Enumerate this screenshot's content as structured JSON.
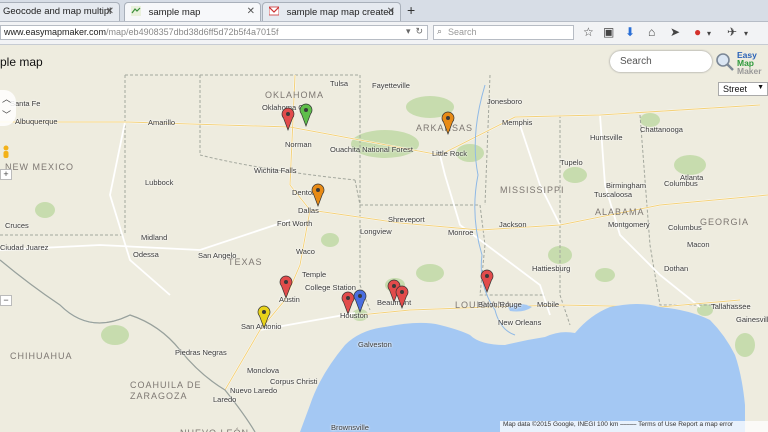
{
  "browser": {
    "tabs": [
      {
        "label": "Geocode and map multipl",
        "active": false
      },
      {
        "label": "sample map",
        "active": true
      },
      {
        "label": "sample map map created",
        "active": false
      }
    ],
    "new_tab_symbol": "+",
    "tab_close_symbol": "✕",
    "url_host": "www.easymapmaker.com",
    "url_path": "/map/eb4908357dbd38d6ff5d72b5f4a7015f",
    "search_placeholder": "Search",
    "toolbar_icons": [
      "star-icon",
      "reading-list-icon",
      "download-icon",
      "home-icon",
      "send-icon",
      "addon-icon",
      "menu-icon"
    ]
  },
  "page": {
    "title": "ple map",
    "search_placeholder": "Search",
    "logo": {
      "line1": "Easy",
      "line2": "Map",
      "line3": "Maker"
    },
    "map_type": "Street",
    "footer": "Map data ©2015 Google, INEGI    100 km ⎯⎯⎯⎯⎯     Terms of Use     Report a map error",
    "zoom_in": "+",
    "zoom_out": "−"
  },
  "map": {
    "colors": {
      "land": "#eeecdf",
      "water": "#a4c8f3",
      "park": "#c7dcae",
      "border": "#9aa19a",
      "road": "#ffffff",
      "highway": "#f6d67c"
    },
    "states": [
      {
        "text": "OKLAHOMA"
      },
      {
        "text": "ARKANSAS"
      },
      {
        "text": "MISSISSIPPI"
      },
      {
        "text": "ALABAMA"
      },
      {
        "text": "GEORGIA"
      },
      {
        "text": "TEXAS"
      },
      {
        "text": "LOUISIANA"
      },
      {
        "text": "NEW MEXICO"
      },
      {
        "text": "CHIHUAHUA"
      },
      {
        "text": "COAHUILA DE"
      },
      {
        "text": "ZARAGOZA"
      },
      {
        "text": "NUEVO LEÓN"
      }
    ],
    "cities": [
      "Tulsa",
      "Fayetteville",
      "Jonesboro",
      "Santa Fe",
      "Oklahoma City",
      "Amarillo",
      "Norman",
      "Memphis",
      "Little Rock",
      "Huntsville",
      "Chattanooga",
      "Atlanta",
      "Wichita Falls",
      "Lubbock",
      "Ouachita National Forest",
      "Tupelo",
      "Birmingham",
      "Columbus",
      "Tuscaloosa",
      "Denton",
      "Dallas",
      "Fort Worth",
      "Shreveport",
      "Monroe",
      "Jackson",
      "Montgomery",
      "Columbus",
      "Macon",
      "Midland",
      "Odessa",
      "Longview",
      "Waco",
      "San Angelo",
      "Hattiesburg",
      "Dothan",
      "Austin",
      "Temple",
      "College Station",
      "Beaumont",
      "Baton Rouge",
      "Mobile",
      "Tallahassee",
      "Houston",
      "San Antonio",
      "New Orleans",
      "Galveston",
      "Piedras Negras",
      "Monclova",
      "Nuevo Laredo",
      "Laredo",
      "Corpus Christi",
      "Brownsville",
      "Gainesville",
      "Ciudad Juarez",
      "Cruces",
      "Albuquerque"
    ],
    "markers": [
      {
        "color": "#e24b4b"
      },
      {
        "color": "#5fbe4b"
      },
      {
        "color": "#e88b16"
      },
      {
        "color": "#e88b16"
      },
      {
        "color": "#e24b4b"
      },
      {
        "color": "#e8d21a"
      },
      {
        "color": "#e24b4b"
      },
      {
        "color": "#4a6ee0"
      },
      {
        "color": "#e24b4b"
      },
      {
        "color": "#e24b4b"
      },
      {
        "color": "#e24b4b"
      }
    ]
  }
}
